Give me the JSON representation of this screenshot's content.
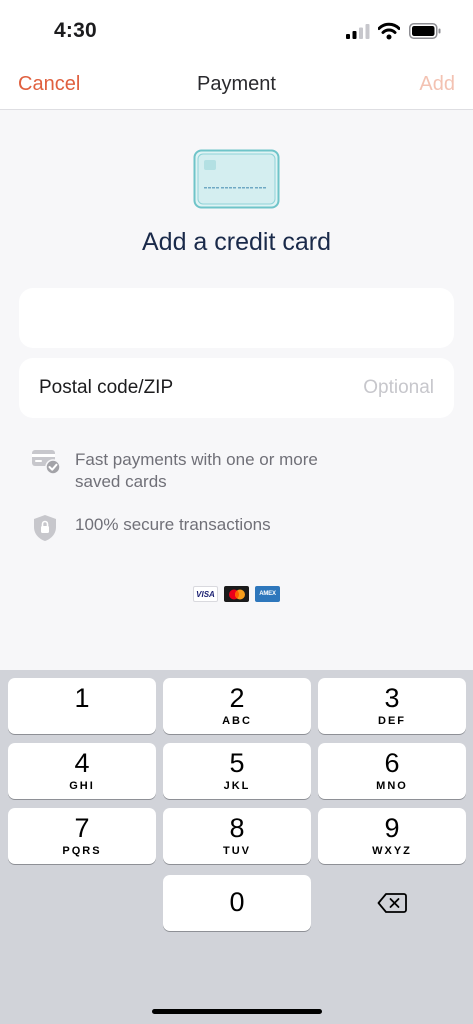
{
  "status_bar": {
    "time": "4:30"
  },
  "nav": {
    "cancel_label": "Cancel",
    "title": "Payment",
    "add_label": "Add"
  },
  "heading": "Add a credit card",
  "card_field": {
    "value": ""
  },
  "zip_field": {
    "label": "Postal code/ZIP",
    "placeholder": "Optional",
    "value": ""
  },
  "benefits": [
    {
      "icon": "card-check-icon",
      "text": "Fast payments with one or more saved cards"
    },
    {
      "icon": "shield-lock-icon",
      "text": "100% secure transactions"
    }
  ],
  "card_logos": {
    "visa": "VISA",
    "amex": "AMEX"
  },
  "keypad": {
    "keys": [
      {
        "digit": "1",
        "letters": ""
      },
      {
        "digit": "2",
        "letters": "ABC"
      },
      {
        "digit": "3",
        "letters": "DEF"
      },
      {
        "digit": "4",
        "letters": "GHI"
      },
      {
        "digit": "5",
        "letters": "JKL"
      },
      {
        "digit": "6",
        "letters": "MNO"
      },
      {
        "digit": "7",
        "letters": "PQRS"
      },
      {
        "digit": "8",
        "letters": "TUV"
      },
      {
        "digit": "9",
        "letters": "WXYZ"
      },
      {
        "digit": "0",
        "letters": ""
      }
    ],
    "delete_icon": "backspace-icon"
  },
  "colors": {
    "accent": "#e0603f",
    "accent_disabled": "#f3c2b2",
    "heading": "#1a2a4a",
    "card_illustration": "#6fc4c9"
  }
}
